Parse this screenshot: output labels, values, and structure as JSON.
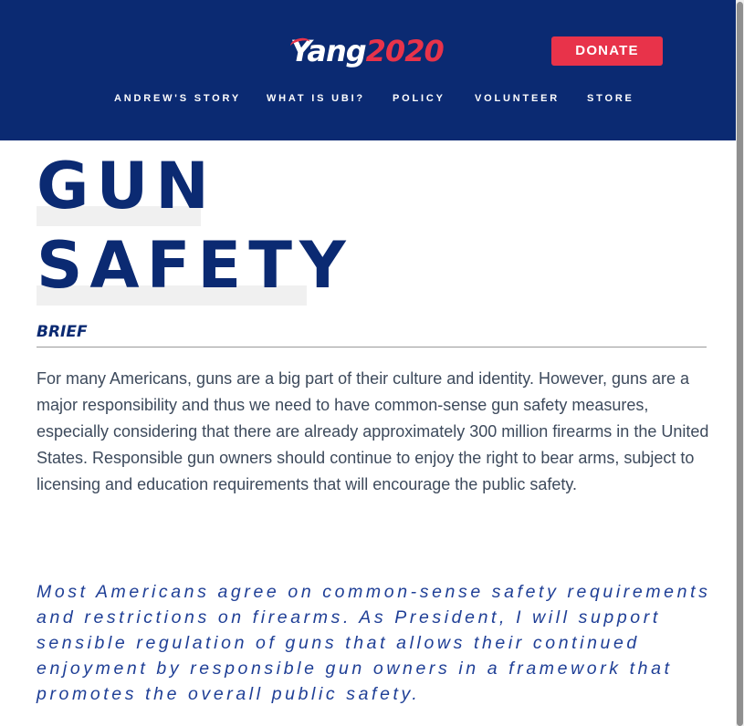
{
  "header": {
    "logo": {
      "name": "Yang",
      "year": "2020"
    },
    "donate_label": "DONATE",
    "nav": [
      {
        "label": "ANDREW'S STORY"
      },
      {
        "label": "WHAT IS UBI?"
      },
      {
        "label": "POLICY"
      },
      {
        "label": "VOLUNTEER"
      },
      {
        "label": "STORE"
      }
    ]
  },
  "main": {
    "title_line1": "GUN",
    "title_line2": "SAFETY",
    "brief_heading": "BRIEF",
    "brief_text": "For many Americans, guns are a big part of their culture and identity. However, guns are a major responsibility and thus we need to have common-sense gun safety measures, especially considering that there are already approximately 300 million firearms in the United States. Responsible gun owners should continue to enjoy the right to bear arms, subject to licensing and education requirements that will encourage the public safety.",
    "quote": "Most Americans agree on common-sense safety requirements and restrictions on firearms. As President, I will support sensible regulation of guns that allows their continued enjoyment by responsible gun owners in a framework that promotes the overall public safety."
  },
  "colors": {
    "header_bg": "#0b2a72",
    "accent_red": "#e8334a",
    "title_blue": "#0b2a72",
    "quote_blue": "#1f3f96",
    "body_text": "#3d4a5c"
  }
}
